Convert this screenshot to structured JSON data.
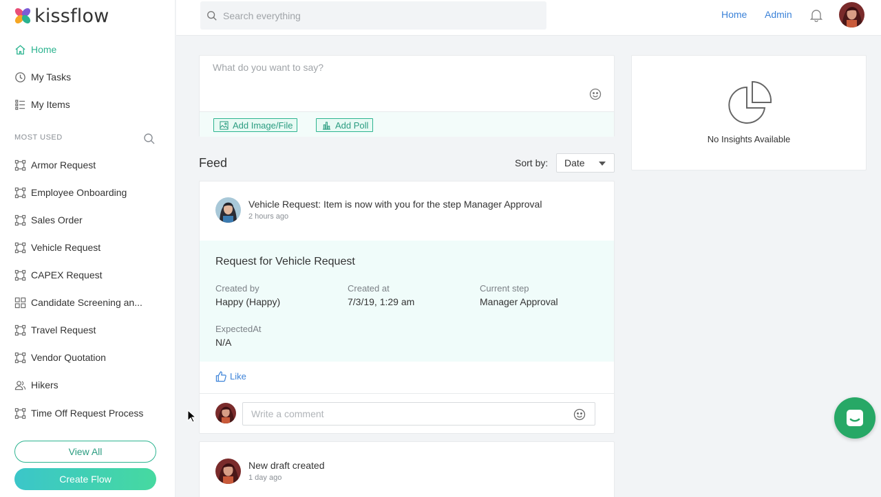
{
  "brand": {
    "name": "kissflow"
  },
  "nav": {
    "primary": [
      {
        "label": "Home",
        "icon": "home-icon",
        "active": true
      },
      {
        "label": "My Tasks",
        "icon": "clock-icon",
        "active": false
      },
      {
        "label": "My Items",
        "icon": "list-icon",
        "active": false
      }
    ],
    "section_label": "MOST USED",
    "most_used": [
      {
        "label": "Armor Request",
        "icon": "process-icon"
      },
      {
        "label": "Employee Onboarding",
        "icon": "process-icon"
      },
      {
        "label": "Sales Order",
        "icon": "process-icon"
      },
      {
        "label": "Vehicle Request",
        "icon": "process-icon"
      },
      {
        "label": "CAPEX Request",
        "icon": "process-icon"
      },
      {
        "label": "Candidate Screening an...",
        "icon": "grid-icon"
      },
      {
        "label": "Travel Request",
        "icon": "process-icon"
      },
      {
        "label": "Vendor Quotation",
        "icon": "process-icon"
      },
      {
        "label": "Hikers",
        "icon": "users-icon"
      },
      {
        "label": "Time Off Request Process",
        "icon": "process-icon"
      }
    ],
    "view_all_label": "View All",
    "create_flow_label": "Create Flow"
  },
  "topbar": {
    "search_placeholder": "Search everything",
    "links": [
      "Home",
      "Admin"
    ]
  },
  "composer": {
    "placeholder": "What do you want to say?",
    "add_image_label": "Add Image/File",
    "add_poll_label": "Add Poll"
  },
  "feed": {
    "title": "Feed",
    "sort_label": "Sort by:",
    "sort_value": "Date",
    "items": [
      {
        "title": "Vehicle Request: Item is now with you for the step Manager Approval",
        "time": "2 hours ago",
        "detail": {
          "title": "Request for Vehicle Request",
          "fields": [
            {
              "label": "Created by",
              "value": "Happy (Happy)"
            },
            {
              "label": "Created at",
              "value": "7/3/19, 1:29 am"
            },
            {
              "label": "Current step",
              "value": "Manager Approval"
            },
            {
              "label": "ExpectedAt",
              "value": "N/A"
            }
          ]
        },
        "like_label": "Like",
        "comment_placeholder": "Write a comment"
      },
      {
        "title": "New draft created",
        "time": "1 day ago"
      }
    ]
  },
  "insights": {
    "text": "No Insights Available"
  },
  "colors": {
    "accent": "#2bb38f",
    "link": "#3b82d8",
    "chat": "#27a866"
  }
}
